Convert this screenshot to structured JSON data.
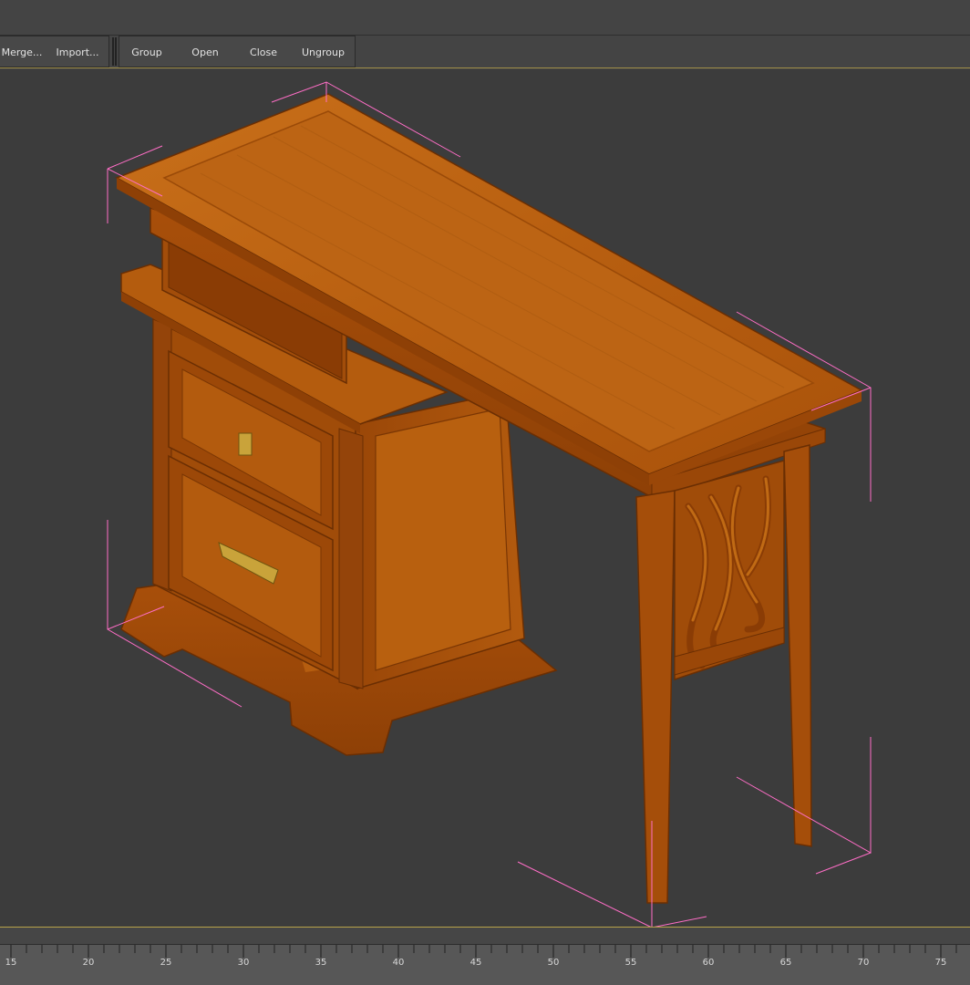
{
  "toolbar": {
    "file_buttons": [
      "Merge...",
      "Import..."
    ],
    "group_buttons": [
      "Group",
      "Open",
      "Close",
      "Ungroup"
    ]
  },
  "viewport": {
    "object": "desk-model",
    "bbox_color": "#ff6ec7",
    "wood_color": "#b8600f"
  },
  "timeline": {
    "ticks": [
      "15",
      "20",
      "25",
      "30",
      "35",
      "40",
      "45",
      "50",
      "55",
      "60",
      "65",
      "70",
      "75"
    ]
  },
  "colors": {
    "accent": "#b8a24a",
    "background": "#3c3c3c"
  }
}
